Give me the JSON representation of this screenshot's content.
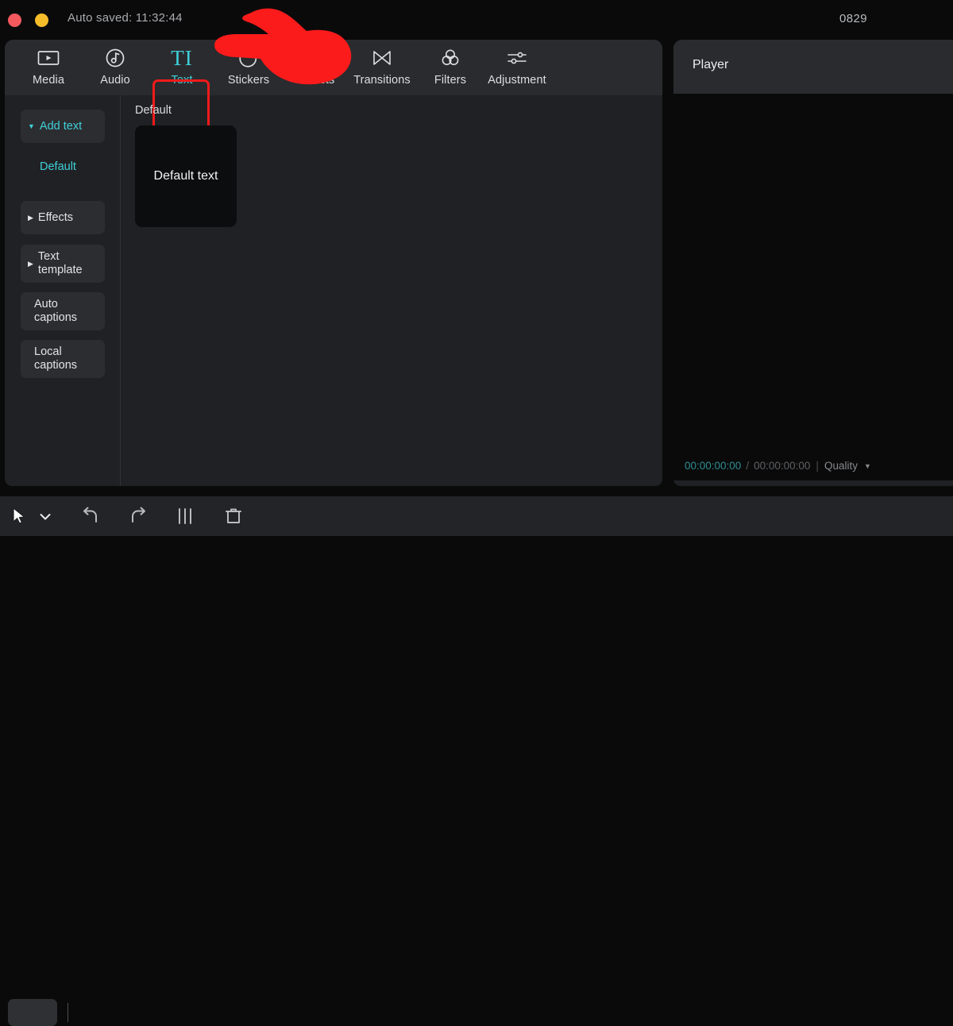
{
  "titlebar": {
    "autosave_label": "Auto saved: 11:32:44",
    "project_name": "0829",
    "dots": [
      {
        "name": "close-dot",
        "color": "#f4595d"
      },
      {
        "name": "minimize-dot",
        "color": "#f6bd2b"
      }
    ]
  },
  "toolbar": {
    "tabs": [
      {
        "label": "Media",
        "icon": "media-icon",
        "active": false
      },
      {
        "label": "Audio",
        "icon": "audio-icon",
        "active": false
      },
      {
        "label": "Text",
        "icon": "text-icon",
        "active": true,
        "glyph": "TI"
      },
      {
        "label": "Stickers",
        "icon": "stickers-icon",
        "active": false
      },
      {
        "label": "Effects",
        "icon": "effects-icon",
        "active": false
      },
      {
        "label": "Transitions",
        "icon": "transitions-icon",
        "active": false
      },
      {
        "label": "Filters",
        "icon": "filters-icon",
        "active": false
      },
      {
        "label": "Adjustment",
        "icon": "adjustment-icon",
        "active": false
      }
    ],
    "highlight_color": "#f31a1a",
    "accent_color": "#3fd0d9"
  },
  "sidebar": {
    "items": [
      {
        "label": "Add text",
        "caret": "down",
        "accent": true,
        "boxed": true
      },
      {
        "label": "Default",
        "caret": "none",
        "accent": true,
        "boxed": false
      },
      {
        "label": "Effects",
        "caret": "right",
        "accent": false,
        "boxed": true
      },
      {
        "label": "Text template",
        "caret": "right",
        "accent": false,
        "boxed": true
      },
      {
        "label": "Auto captions",
        "caret": "none",
        "accent": false,
        "boxed": true
      },
      {
        "label": "Local captions",
        "caret": "none",
        "accent": false,
        "boxed": true
      }
    ]
  },
  "content": {
    "section_title": "Default",
    "cards": [
      {
        "label": "Default text"
      }
    ]
  },
  "player": {
    "title": "Player",
    "current_time": "00:00:00:00",
    "separator": "/",
    "duration": "00:00:00:00",
    "divider": "|",
    "quality_label": "Quality",
    "current_time_color": "#2e8d91"
  },
  "bottom_toolbar": {
    "tools": [
      {
        "name": "select-cursor-tool",
        "icon": "cursor-icon"
      },
      {
        "name": "cursor-dropdown",
        "icon": "chevron-down-icon"
      },
      {
        "name": "undo-tool",
        "icon": "undo-icon"
      },
      {
        "name": "redo-tool",
        "icon": "redo-icon"
      },
      {
        "name": "split-tool",
        "icon": "split-icon"
      },
      {
        "name": "delete-tool",
        "icon": "trash-icon"
      }
    ]
  },
  "annotation": {
    "hand_color": "#fb1b1b",
    "type": "pointing-hand"
  }
}
